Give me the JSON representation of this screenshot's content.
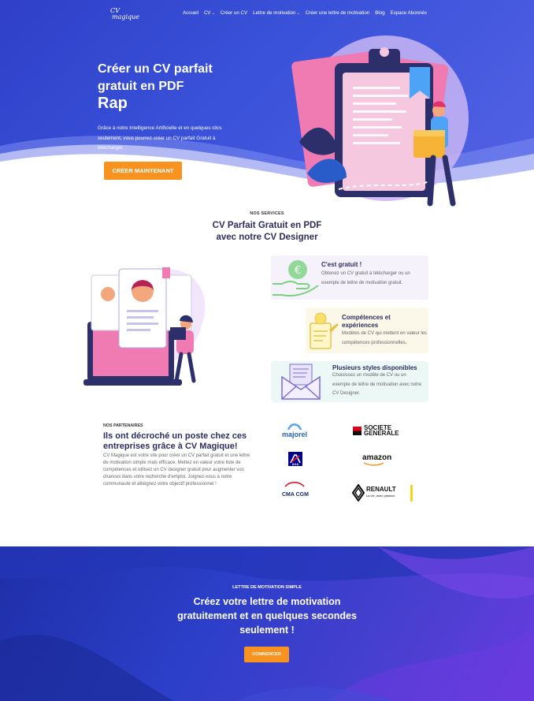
{
  "nav": {
    "logo_line1": "CV",
    "logo_line2": "magique",
    "links": [
      "Accueil",
      "CV",
      "Créer un CV",
      "Lettre de motivation",
      "Créer une lettre de motivation",
      "Blog",
      "Espace Abonnés"
    ]
  },
  "hero": {
    "title": "Créer un CV parfait gratuit en PDF",
    "title_accent": "Rap",
    "description": "Grâce à notre Intelligence Artificielle et en quelques clics seulement, vous pourrez créer un CV parfait Gratuit à télécharger.",
    "button": "CRÉER MAINTENANT"
  },
  "services": {
    "kicker": "NOS SERVICES",
    "title_line1": "CV Parfait Gratuit en PDF",
    "title_line2": "avec notre CV Designer",
    "cards": [
      {
        "title": "C'est gratuit !",
        "description": "Obtenez un CV gratuit à télécharger ou un exemple de lettre de motivation gratuit.",
        "icon": "euro-hand-icon"
      },
      {
        "title": "Compétences et expériences",
        "description": "Modèles de CV qui mettent en valeur les compétences professionnelles.",
        "icon": "lightbulb-document-icon"
      },
      {
        "title": "Plusieurs styles disponibles",
        "description": "Choisissez un modèle de CV ou un exemple de lettre de motivation avec notre CV Designer.",
        "icon": "envelope-letter-icon"
      }
    ]
  },
  "partners": {
    "kicker": "NOS PARTENAIRES",
    "title": "Ils ont décroché un poste chez ces entreprises grâce à CV Magique!",
    "description": "CV Magique est votre site pour créer un CV parfait gratuit et une lettre de motivation simple mais efficace. Mettez en valeur votre liste de compétences et utilisez un CV designer gratuit pour augmenter vos chances dans votre recherche d'emploi. Joignez-vous à notre communauté et atteignez votre objectif professionnel !",
    "logos": {
      "majorel": "majorel",
      "sg_line1": "SOCIETE",
      "sg_line2": "GENERALE",
      "axa": "AXA",
      "amazon": "amazon",
      "cma": "CMA CGM",
      "renault": "RENAULT",
      "renault_tagline": "La vie, avec passion"
    }
  },
  "cta": {
    "kicker": "LETTRE DE MOTIVATION SIMPLE",
    "title": "Créez votre lettre de motivation gratuitement et en quelques secondes seulement !",
    "button": "COMMENCER"
  },
  "colors": {
    "primary_blue": "#3a52d9",
    "accent_orange": "#f7931e",
    "heading_navy": "#2d2d5f"
  }
}
